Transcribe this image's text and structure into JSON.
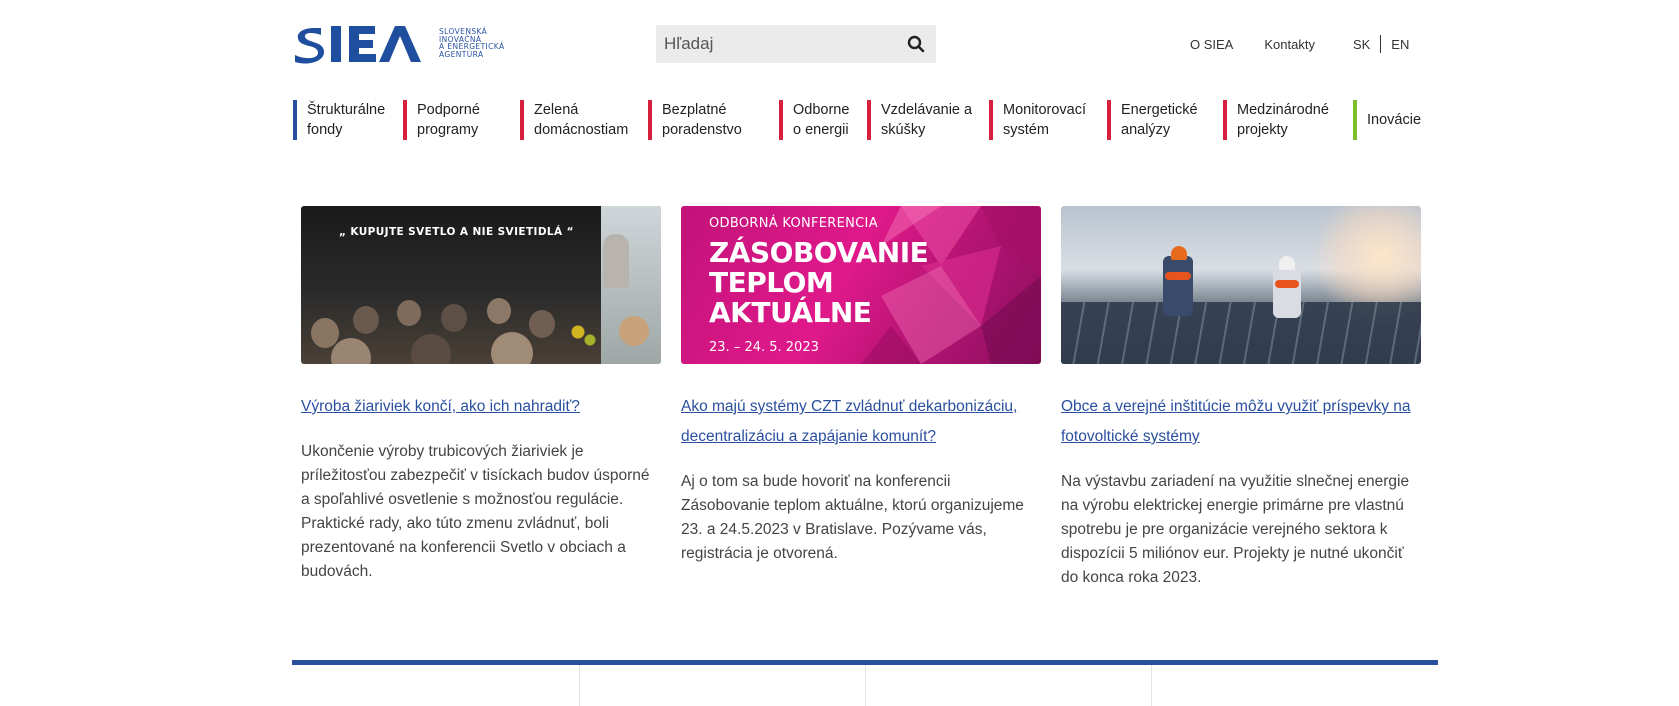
{
  "brand": {
    "logo_text": "SIEA",
    "tagline": [
      "SLOVENSKÁ",
      "INOVAČNÁ",
      "A ENERGETICKÁ",
      "AGENTÚRA"
    ],
    "color_primary": "#1f4e9f"
  },
  "search": {
    "placeholder": "Hľadaj",
    "icon": "search-icon"
  },
  "top_links": {
    "about": "O SIEA",
    "contacts": "Kontakty",
    "lang_sk": "SK",
    "lang_en": "EN"
  },
  "nav": {
    "items": [
      {
        "label": "Štrukturálne\nfondy",
        "color": "#2a4f9f"
      },
      {
        "label": "Podporné\nprogramy",
        "color": "#d6203e"
      },
      {
        "label": "Zelená\ndomácnostiam",
        "color": "#d6203e"
      },
      {
        "label": "Bezplatné\nporadenstvo",
        "color": "#d6203e"
      },
      {
        "label": "Odborne\no energii",
        "color": "#d6203e"
      },
      {
        "label": "Vzdelávanie a\nskúšky",
        "color": "#d6203e"
      },
      {
        "label": "Monitorovací\nsystém",
        "color": "#d6203e"
      },
      {
        "label": "Energetické\nanalýzy",
        "color": "#d6203e"
      },
      {
        "label": "Medzinárodné\nprojekty",
        "color": "#d6203e"
      },
      {
        "label": "Inovácie",
        "color": "#7cbf2a"
      }
    ]
  },
  "articles": [
    {
      "image_caption": "„ KUPUJTE SVETLO A NIE SVIETIDLÁ “",
      "title": "Výroba žiariviek končí, ako ich nahradiť?",
      "text": "Ukončenie výroby trubicových žiariviek je príležitosťou zabezpečiť v tisíckach budov úsporné a spoľahlivé osvetlenie s možnosťou regulácie. Praktické rady, ako túto zmenu zvládnuť, boli prezentované na konferencii Svetlo v obciach a budovách."
    },
    {
      "image_kicker": "ODBORNÁ KONFERENCIA",
      "image_headline": "ZÁSOBOVANIE\nTEPLOM\nAKTUÁLNE",
      "image_date": "23. – 24. 5. 2023",
      "title": "Ako majú systémy CZT zvládnuť dekarbonizáciu, decentralizáciu a zapájanie komunít?",
      "text": "Aj o tom sa bude hovoriť na konferencii Zásobovanie teplom aktuálne, ktorú organizujeme 23. a 24.5.2023 v Bratislave. Pozývame vás, registrácia je otvorená."
    },
    {
      "title": "Obce a verejné inštitúcie môžu využiť príspevky na fotovoltické systémy",
      "text": "Na výstavbu zariadení na využitie slnečnej energie na výrobu elektrickej energie primárne pre vlastnú spotrebu je pre organizácie verejného sektora k dispozícii 5 miliónov eur. Projekty je nutné ukončiť do konca roka 2023."
    }
  ]
}
